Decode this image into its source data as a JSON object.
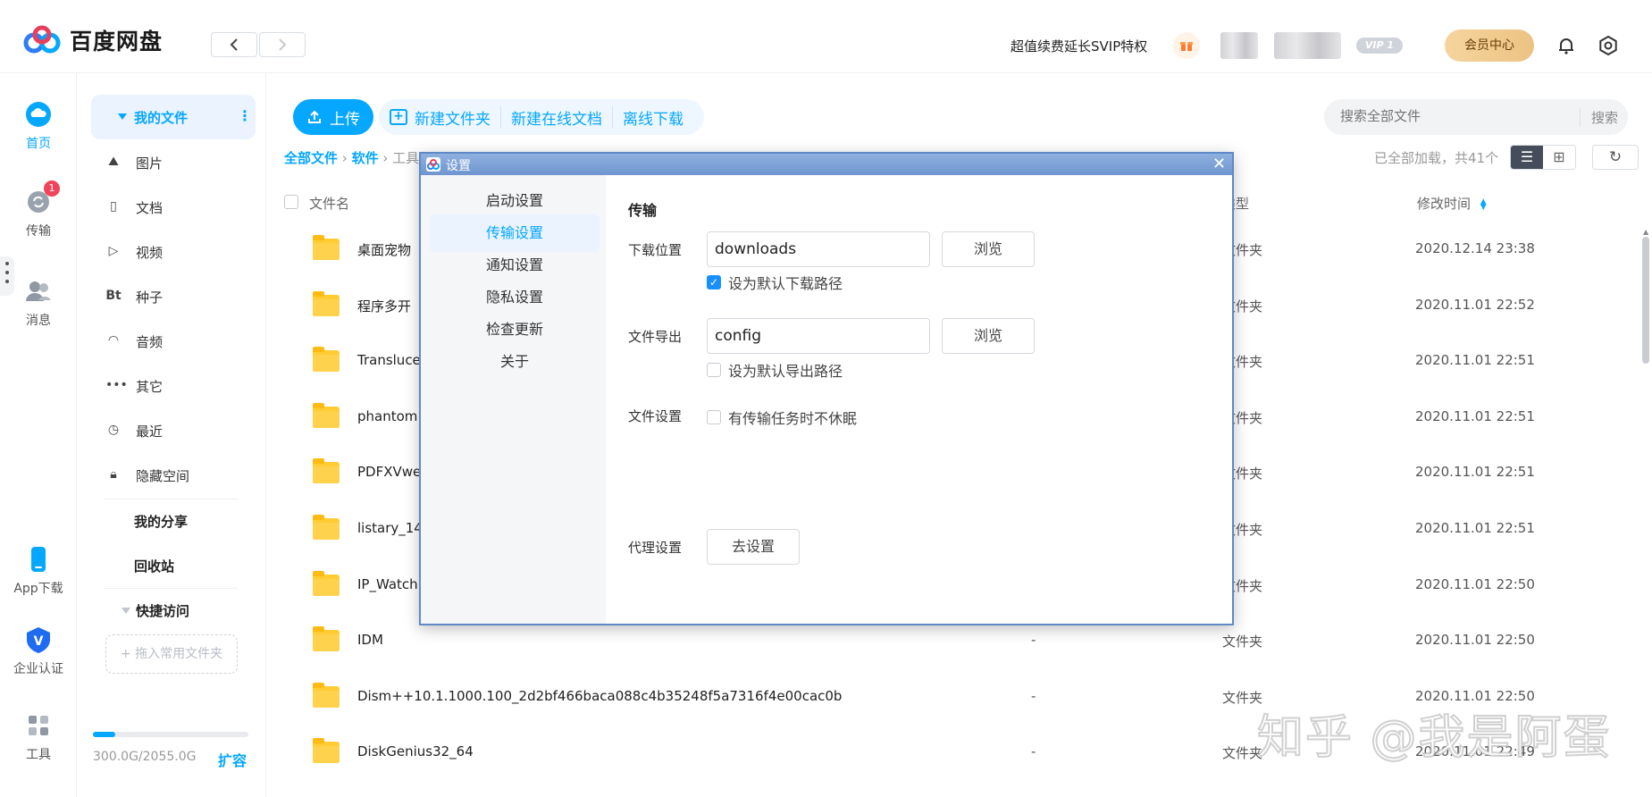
{
  "app": {
    "name": "百度网盘",
    "promo_text": "超值续费延长SVIP特权",
    "vip_badge": "VIP 1",
    "member_center": "会员中心",
    "accent": "#06a7ff"
  },
  "rail": {
    "items": [
      {
        "label": "首页",
        "icon": "cloud-home-icon"
      },
      {
        "label": "传输",
        "icon": "transfer-icon",
        "badge": "1"
      },
      {
        "label": "消息",
        "icon": "message-icon"
      },
      {
        "label": "App下载",
        "icon": "phone-icon"
      },
      {
        "label": "企业认证",
        "icon": "enterprise-shield-icon"
      },
      {
        "label": "工具",
        "icon": "tools-grid-icon"
      }
    ]
  },
  "sidebar": {
    "my_files": "我的文件",
    "items": [
      {
        "label": "图片",
        "icon": "image-icon"
      },
      {
        "label": "文档",
        "icon": "document-icon"
      },
      {
        "label": "视频",
        "icon": "video-play-icon"
      },
      {
        "label": "种子",
        "icon": "bt-icon",
        "glyph": "Bt"
      },
      {
        "label": "音频",
        "icon": "headphones-icon"
      },
      {
        "label": "其它",
        "icon": "more-dots-icon"
      },
      {
        "label": "最近",
        "icon": "recent-clock-icon"
      },
      {
        "label": "隐藏空间",
        "icon": "lock-icon"
      }
    ],
    "my_share": "我的分享",
    "recycle": "回收站",
    "quick_access": "快捷访问",
    "drop_zone": "+ 拖入常用文件夹",
    "storage_text": "300.0G/2055.0G",
    "storage_fraction": 0.146,
    "expand": "扩容"
  },
  "toolbar": {
    "upload": "上传",
    "new_folder": "新建文件夹",
    "new_online_doc": "新建在线文档",
    "offline_download": "离线下载",
    "search_placeholder": "搜索全部文件",
    "search_button": "搜索"
  },
  "breadcrumb": {
    "root": "全部文件",
    "level1": "软件",
    "level2": "工具"
  },
  "list_status": "已全部加载，共41个",
  "table": {
    "col_name": "文件名",
    "col_type": "类型",
    "col_time": "修改时间",
    "rows": [
      {
        "name": "桌面宠物",
        "size": "",
        "type": "文件夹",
        "time": "2020.12.14 23:38"
      },
      {
        "name": "程序多开",
        "size": "",
        "type": "文件夹",
        "time": "2020.11.01 22:52"
      },
      {
        "name": "Transluce",
        "size": "",
        "type": "文件夹",
        "time": "2020.11.01 22:51"
      },
      {
        "name": "phantom",
        "size": "",
        "type": "文件夹",
        "time": "2020.11.01 22:51"
      },
      {
        "name": "PDFXVwe",
        "size": "",
        "type": "文件夹",
        "time": "2020.11.01 22:51"
      },
      {
        "name": "listary_14",
        "size": "",
        "type": "文件夹",
        "time": "2020.11.01 22:51"
      },
      {
        "name": "IP_Watch",
        "size": "",
        "type": "文件夹",
        "time": "2020.11.01 22:50"
      },
      {
        "name": "IDM",
        "size": "-",
        "type": "文件夹",
        "time": "2020.11.01 22:50"
      },
      {
        "name": "Dism++10.1.1000.100_2d2bf466baca088c4b35248f5a7316f4e00cac0b",
        "size": "-",
        "type": "文件夹",
        "time": "2020.11.01 22:50"
      },
      {
        "name": "DiskGenius32_64",
        "size": "-",
        "type": "文件夹",
        "time": "2020.11.01 22:49"
      }
    ]
  },
  "watermark": "知乎 @我是阿蛋",
  "dialog": {
    "title": "设置",
    "close": "✕",
    "nav": [
      "启动设置",
      "传输设置",
      "通知设置",
      "隐私设置",
      "检查更新",
      "关于"
    ],
    "active_nav": "传输设置",
    "section_title": "传输",
    "download_location_label": "下载位置",
    "download_location_value": "downloads",
    "browse": "浏览",
    "default_download_path": "设为默认下载路径",
    "default_download_checked": true,
    "export_label": "文件导出",
    "export_value": "config",
    "default_export_path": "设为默认导出路径",
    "default_export_checked": false,
    "file_settings_label": "文件设置",
    "no_sleep": "有传输任务时不休眠",
    "no_sleep_checked": false,
    "proxy_label": "代理设置",
    "proxy_button": "去设置"
  }
}
